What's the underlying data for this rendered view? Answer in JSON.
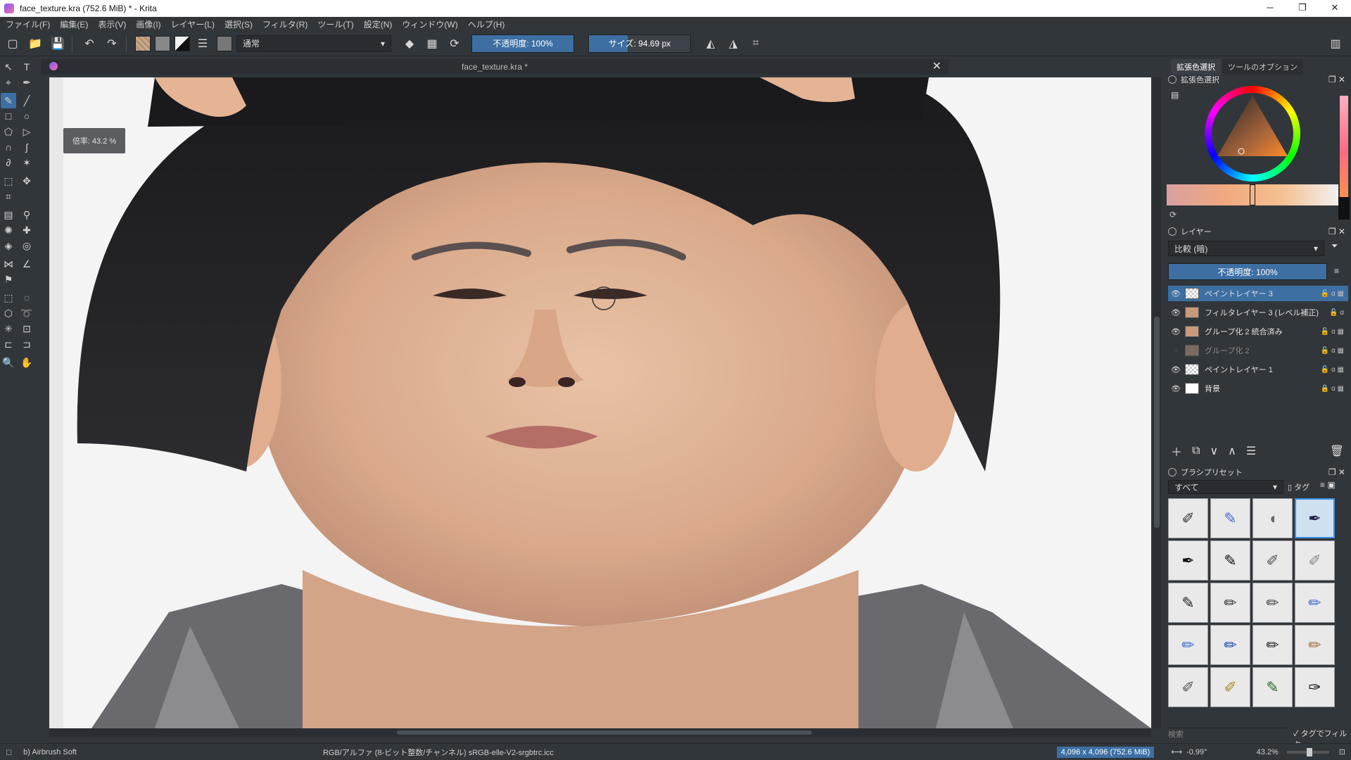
{
  "window": {
    "title": "face_texture.kra (752.6 MiB)  * - Krita",
    "controls": [
      "─",
      "❐",
      "✕"
    ]
  },
  "menu": [
    "ファイル(F)",
    "編集(E)",
    "表示(V)",
    "画像(I)",
    "レイヤー(L)",
    "選択(S)",
    "フィルタ(R)",
    "ツール(T)",
    "設定(N)",
    "ウィンドウ(W)",
    "ヘルプ(H)"
  ],
  "toolbar": {
    "blend_mode": "通常",
    "opacity_label": "不透明度: 100%",
    "opacity_value": 1.0,
    "size_label": "サイズ: 94.69 px",
    "size_fill": 0.38
  },
  "document": {
    "tab_title": "face_texture.kra *",
    "zoom_tip": "倍率: 43.2 %"
  },
  "dock": {
    "tabs": [
      "拡張色選択",
      "ツールのオプション"
    ],
    "color_panel_title": "拡張色選択",
    "layers_panel_title": "レイヤー",
    "blend_filter": "比較 (暗)",
    "layer_opacity": "不透明度: 100%",
    "layers": [
      {
        "name": "ペイントレイヤー 3",
        "visible": true,
        "selected": true,
        "thumb": "checker"
      },
      {
        "name": "フィルタレイヤー 3 (レベル補正)",
        "visible": true,
        "selected": false,
        "thumb": "face"
      },
      {
        "name": "グループ化 2 統合済み",
        "visible": true,
        "selected": false,
        "thumb": "face"
      },
      {
        "name": "グループ化 2",
        "visible": false,
        "selected": false,
        "thumb": "face-dim"
      },
      {
        "name": "ペイントレイヤー 1",
        "visible": true,
        "selected": false,
        "thumb": "checker"
      },
      {
        "name": "背景",
        "visible": true,
        "selected": false,
        "thumb": "white"
      }
    ],
    "brush_panel_title": "ブラシプリセット",
    "brush_filter": "すべて",
    "brush_tag": "タグ",
    "brush_search_placeholder": "検索",
    "tag_filter_label": "タグでフィルタ"
  },
  "status": {
    "brush_name": "b) Airbrush Soft",
    "color_space": "RGB/アルファ (8-ビット整数/チャンネル)  sRGB-elle-V2-srgbtrc.icc",
    "image_size": "4,096 x 4,096 (752.6 MiB)",
    "rotation": "-0.99°",
    "zoom": "43.2%"
  },
  "colors": {
    "accent": "#3d6fa3",
    "panel_bg": "#31363b",
    "titlebar_bg": "#ffffff"
  }
}
